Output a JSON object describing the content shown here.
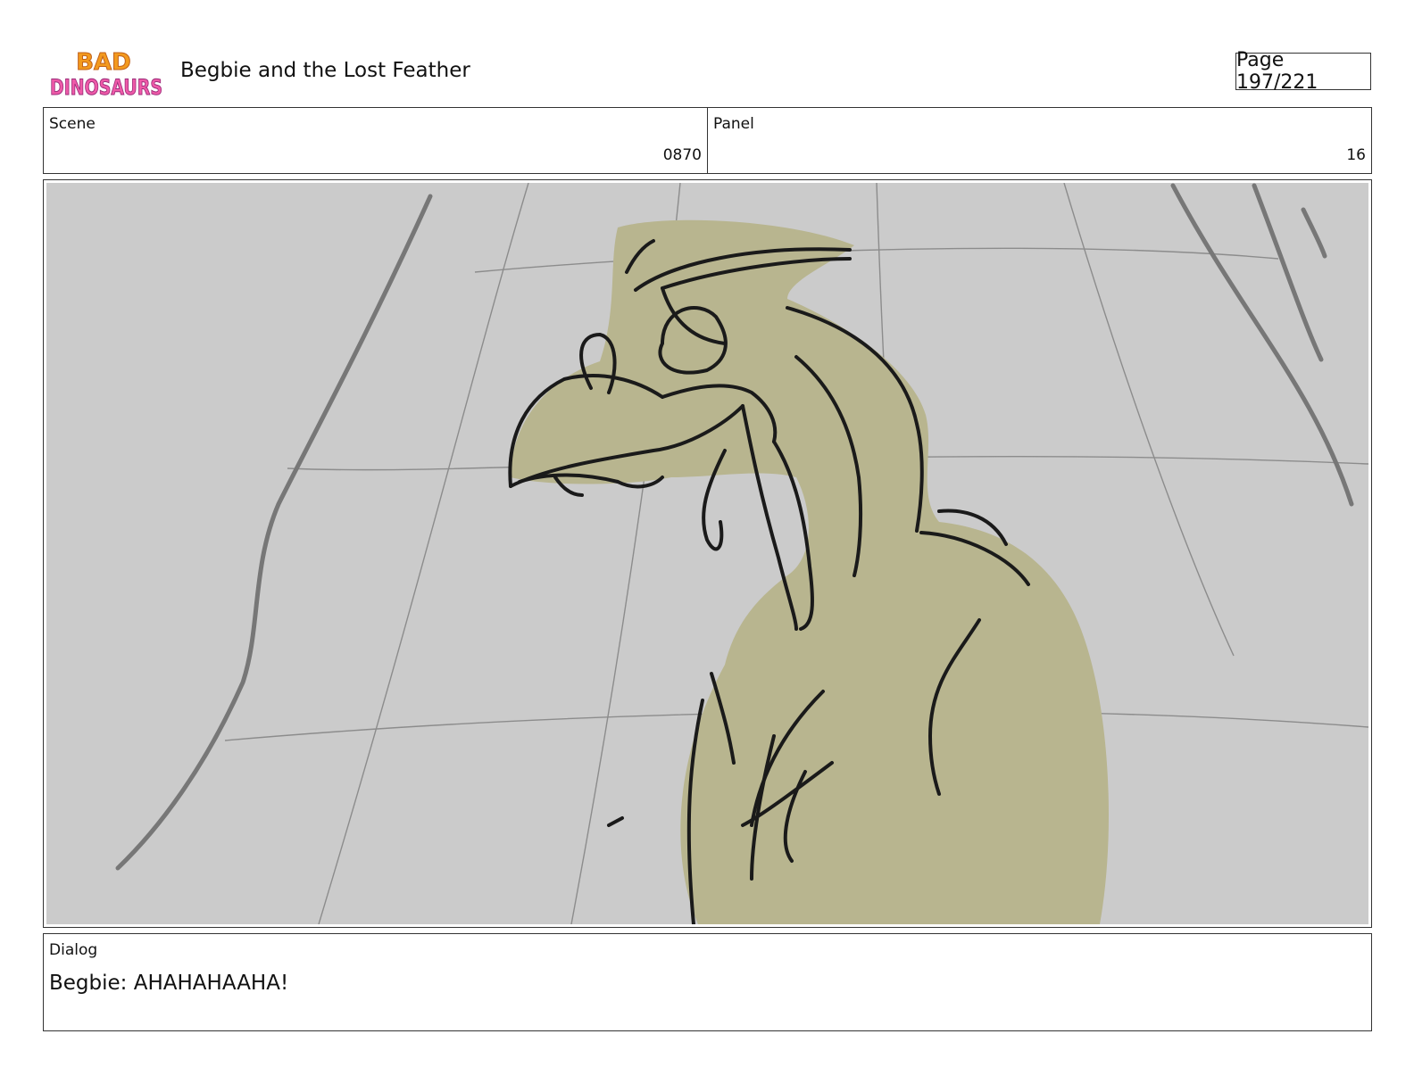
{
  "header": {
    "logo_text": "BAD DINOSAURS",
    "title": "Begbie and the Lost Feather",
    "page": "Page 197/221"
  },
  "info": {
    "scene_label": "Scene",
    "scene_value": "0870",
    "panel_label": "Panel",
    "panel_value": "16"
  },
  "dialog": {
    "label": "Dialog",
    "text": "Begbie: AHAHAHAAHA!"
  },
  "colors": {
    "background": "#cbcbcb",
    "creature": "#b8b58f",
    "line": "#1a1a1a"
  }
}
